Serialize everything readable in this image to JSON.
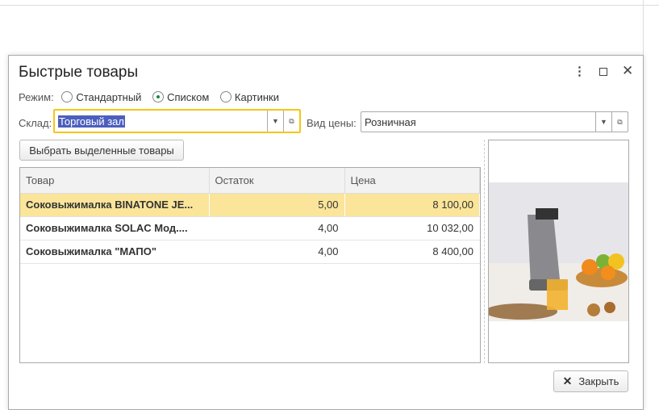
{
  "dialog": {
    "title": "Быстрые товары"
  },
  "mode": {
    "label": "Режим:",
    "options": [
      {
        "label": "Стандартный",
        "selected": false
      },
      {
        "label": "Списком",
        "selected": true
      },
      {
        "label": "Картинки",
        "selected": false
      }
    ]
  },
  "warehouse": {
    "label": "Склад:",
    "value": "Торговый зал"
  },
  "price_type": {
    "label": "Вид цены:",
    "value": "Розничная"
  },
  "select_button": "Выбрать выделенные товары",
  "table": {
    "columns": [
      "Товар",
      "Остаток",
      "Цена"
    ],
    "rows": [
      [
        "Соковыжималка  BINATONE JE...",
        "5,00",
        "8 100,00"
      ],
      [
        "Соковыжималка  SOLAC  Мод....",
        "4,00",
        "10 032,00"
      ],
      [
        "Соковыжималка \"МАПО\"",
        "4,00",
        "8 400,00"
      ]
    ]
  },
  "close_button": "Закрыть",
  "colors": {
    "accent": "#f5c518",
    "selected_row": "#fbe59a"
  }
}
